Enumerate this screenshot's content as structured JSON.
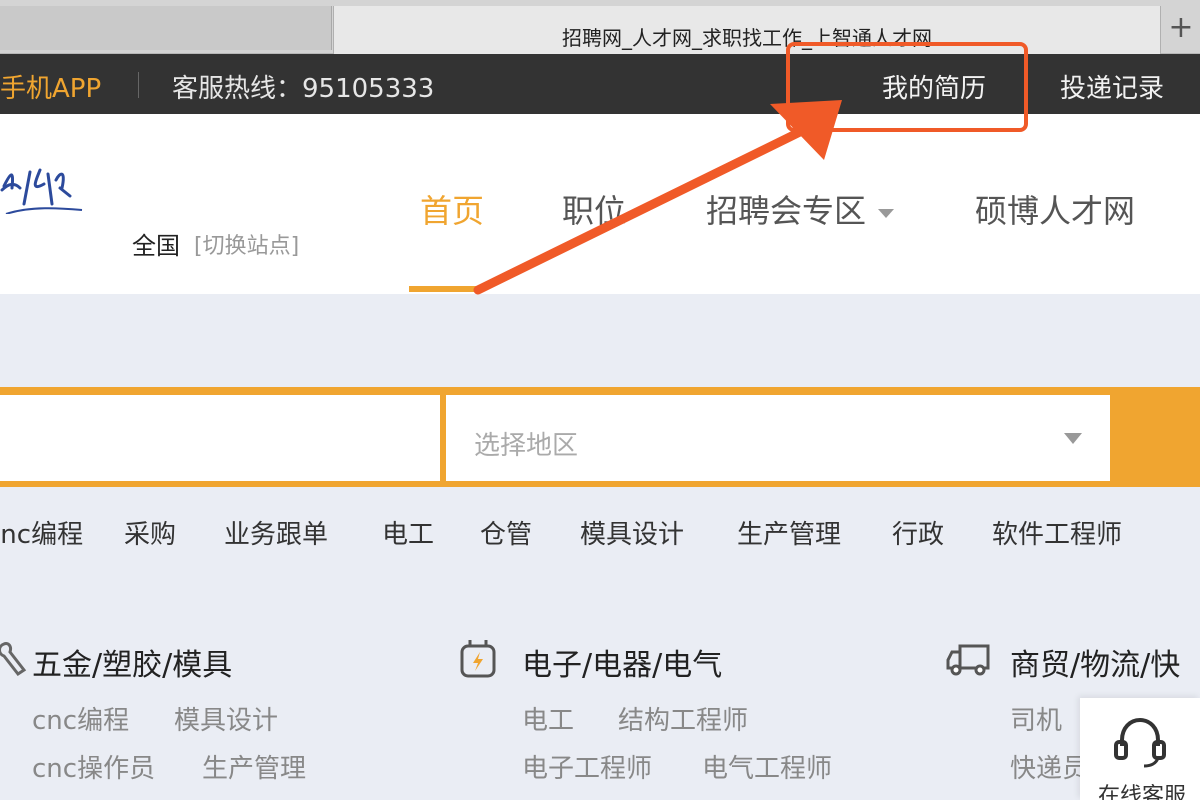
{
  "browser": {
    "tab_title": "招聘网_人才网_求职找工作_上智通人才网",
    "new_tab_symbol": "+"
  },
  "topbar": {
    "app_label": "手机APP",
    "hotline": "客服热线：95105333",
    "resume": "我的简历",
    "delivery": "投递记录"
  },
  "header": {
    "region": "全国",
    "switch_site": "[切换站点]",
    "nav": [
      "首页",
      "职位",
      "招聘会专区",
      "硕博人才网"
    ]
  },
  "search": {
    "keyword_placeholder": "",
    "region_placeholder": "选择地区"
  },
  "hot_keywords": [
    "cnc编程",
    "采购",
    "业务跟单",
    "电工",
    "仓管",
    "模具设计",
    "生产管理",
    "行政",
    "软件工程师"
  ],
  "categories": [
    {
      "icon": "wrench-icon",
      "title": "五金/塑胶/模具",
      "rows": [
        [
          "cnc编程",
          "模具设计"
        ],
        [
          "cnc操作员",
          "生产管理"
        ]
      ]
    },
    {
      "icon": "battery-charge-icon",
      "title": "电子/电器/电气",
      "rows": [
        [
          "电工",
          "结构工程师"
        ],
        [
          "电子工程师",
          "电气工程师"
        ]
      ]
    },
    {
      "icon": "truck-icon",
      "title": "商贸/物流/快",
      "rows": [
        [
          "司机"
        ],
        [
          "快递员"
        ]
      ]
    }
  ],
  "service": {
    "label": "在线客服",
    "icon": "headset-icon"
  },
  "colors": {
    "accent": "#f0a530",
    "topbar": "#333333",
    "annotation": "#f05a28"
  }
}
